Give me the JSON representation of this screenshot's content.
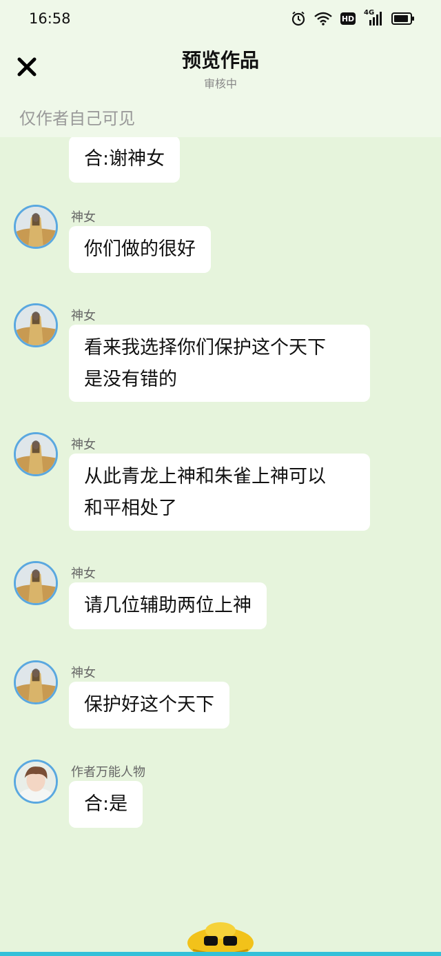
{
  "status": {
    "time": "16:58",
    "network": "4G"
  },
  "header": {
    "title": "预览作品",
    "subtitle": "审核中",
    "visibility": "仅作者自己可见"
  },
  "messages": [
    {
      "speaker": "",
      "lines": [
        "合:谢神女"
      ],
      "avatar": "boy-avatar"
    },
    {
      "speaker": "神女",
      "lines": [
        "你们做的很好"
      ],
      "avatar": "goddess-avatar"
    },
    {
      "speaker": "神女",
      "lines": [
        "看来我选择你们保护这个天下",
        "是没有错的"
      ],
      "avatar": "goddess-avatar"
    },
    {
      "speaker": "神女",
      "lines": [
        "从此青龙上神和朱雀上神可以",
        "和平相处了"
      ],
      "avatar": "goddess-avatar"
    },
    {
      "speaker": "神女",
      "lines": [
        "请几位辅助两位上神"
      ],
      "avatar": "goddess-avatar"
    },
    {
      "speaker": "神女",
      "lines": [
        "保护好这个天下"
      ],
      "avatar": "goddess-avatar"
    },
    {
      "speaker": "作者万能人物",
      "lines": [
        "合:是"
      ],
      "avatar": "boy-avatar"
    }
  ],
  "colors": {
    "background": "#e6f4dc",
    "header": "#eff8e9",
    "avatar_ring": "#5aa8e0",
    "accent_bar": "#34c0d9"
  }
}
